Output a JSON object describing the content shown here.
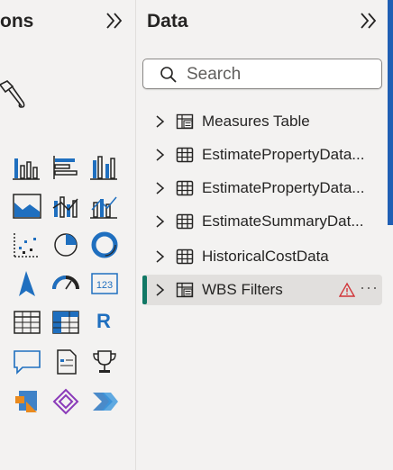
{
  "viz_pane": {
    "title_fragment": "ons"
  },
  "data_pane": {
    "title": "Data",
    "search": {
      "placeholder": "Search",
      "value": ""
    },
    "items": [
      {
        "label": "Measures Table",
        "icon": "measure-table-icon",
        "selected": false,
        "warning": false
      },
      {
        "label": "EstimatePropertyData...",
        "icon": "table-icon",
        "selected": false,
        "warning": false
      },
      {
        "label": "EstimatePropertyData...",
        "icon": "table-icon",
        "selected": false,
        "warning": false
      },
      {
        "label": "EstimateSummaryDat...",
        "icon": "table-icon",
        "selected": false,
        "warning": false
      },
      {
        "label": "HistoricalCostData",
        "icon": "table-icon",
        "selected": false,
        "warning": false
      },
      {
        "label": "WBS Filters",
        "icon": "measure-table-icon",
        "selected": true,
        "warning": true,
        "more": "···"
      }
    ]
  },
  "visuals": {
    "r_label": "R",
    "card_label": "123"
  },
  "colors": {
    "accent_blue": "#1f5fb4",
    "selection_bar": "#117865",
    "warning_red": "#d13438"
  }
}
